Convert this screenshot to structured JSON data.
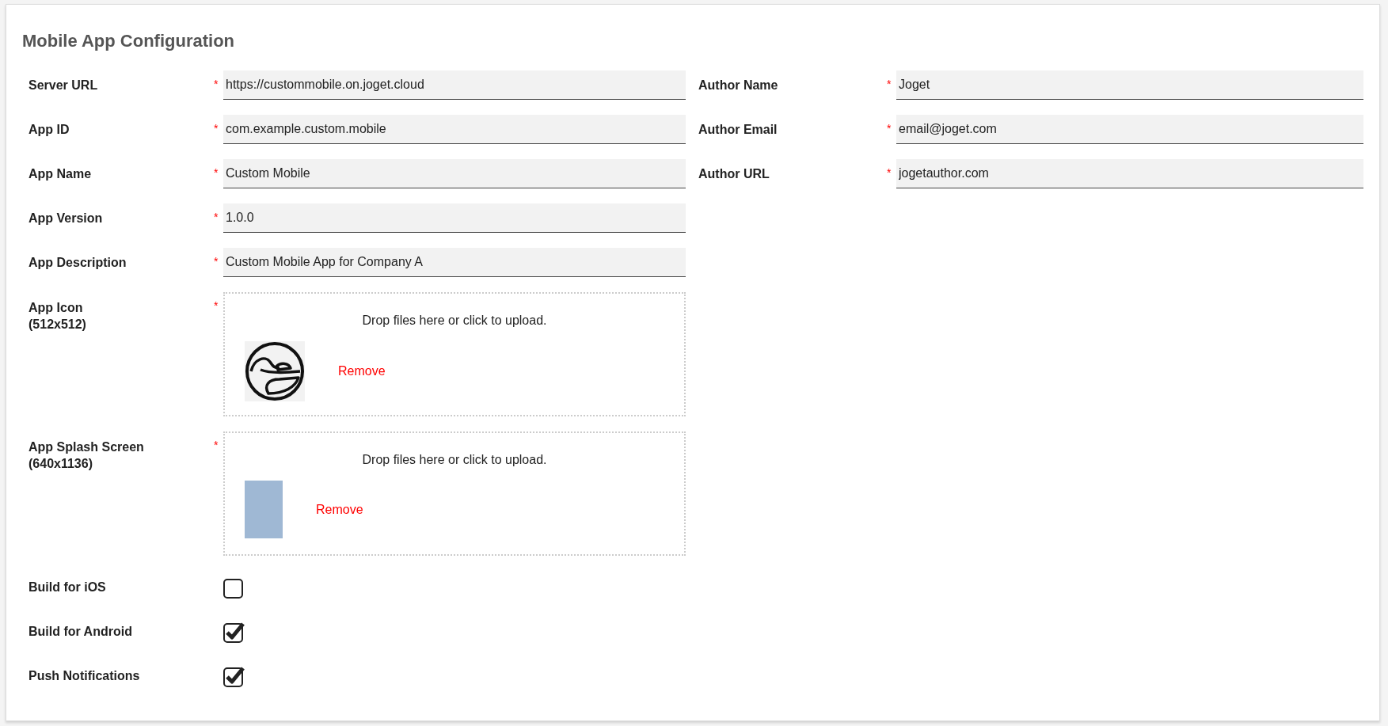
{
  "title": "Mobile App Configuration",
  "left_fields": [
    {
      "kind": "text",
      "label": "Server URL",
      "required_mark": "*",
      "value": "https://custommobile.on.joget.cloud"
    },
    {
      "kind": "text",
      "label": "App ID",
      "required_mark": "*",
      "value": "com.example.custom.mobile"
    },
    {
      "kind": "text",
      "label": "App Name",
      "required_mark": "*",
      "value": "Custom Mobile"
    },
    {
      "kind": "text",
      "label": "App Version",
      "required_mark": "*",
      "value": "1.0.0"
    },
    {
      "kind": "text",
      "label": "App Description",
      "required_mark": "*",
      "value": "Custom Mobile App for Company A"
    },
    {
      "kind": "upload",
      "label": "App Icon",
      "size_hint": "(512x512)",
      "required_mark": "*",
      "prompt": "Drop files here or click to upload.",
      "preview": {
        "kind": "logo"
      },
      "remove": "Remove"
    },
    {
      "kind": "upload",
      "label": "App Splash Screen",
      "size_hint": "(640x1136)",
      "required_mark": "*",
      "prompt": "Drop files here or click to upload.",
      "preview": {
        "kind": "photo"
      },
      "remove": "Remove"
    },
    {
      "kind": "checkbox",
      "label": "Build for iOS",
      "checked": false
    },
    {
      "kind": "checkbox",
      "label": "Build for Android",
      "checked": true
    },
    {
      "kind": "checkbox",
      "label": "Push Notifications",
      "checked": true
    }
  ],
  "right_fields": [
    {
      "kind": "text",
      "label": "Author Name",
      "required_mark": "*",
      "value": "Joget"
    },
    {
      "kind": "text",
      "label": "Author Email",
      "required_mark": "*",
      "value": "email@joget.com"
    },
    {
      "kind": "text",
      "label": "Author URL",
      "required_mark": "*",
      "value": "jogetauthor.com"
    }
  ]
}
